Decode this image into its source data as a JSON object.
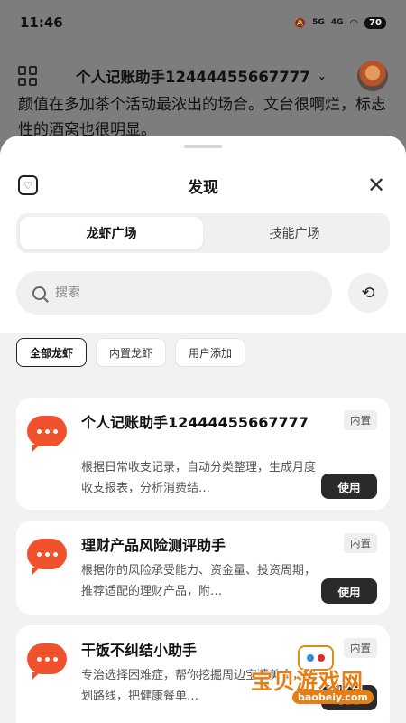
{
  "status": {
    "time": "11:46",
    "signal_a": "5G",
    "signal_b": "4G",
    "battery": "70"
  },
  "background": {
    "title": "个人记账助手12444455667777",
    "text": "颜值在多加茶个活动最浓出的场合。文台很啊烂，标志性的酒窝也很明显。"
  },
  "sheet": {
    "title": "发现",
    "tabs": [
      {
        "label": "龙虾广场",
        "active": true
      },
      {
        "label": "技能广场",
        "active": false
      }
    ],
    "search_placeholder": "搜索",
    "filters": [
      {
        "label": "全部龙虾",
        "active": true
      },
      {
        "label": "内置龙虾",
        "active": false
      },
      {
        "label": "用户添加",
        "active": false
      }
    ],
    "cards": [
      {
        "title": "个人记账助手12444455667777",
        "desc": "根据日常收支记录，自动分类整理，生成月度收支报表，分析消费结…",
        "tag": "内置",
        "button": "使用"
      },
      {
        "title": "理财产品风险测评助手",
        "desc": "根据你的风险承受能力、资金量、投资周期，推荐适配的理财产品，附…",
        "tag": "内置",
        "button": "使用"
      },
      {
        "title": "干饭不纠结小助手",
        "desc": "专治选择困难症，帮你挖掘周边宝藏美食，规划路线，把健康餐单…",
        "tag": "内置",
        "button": "使用"
      }
    ]
  },
  "watermark": {
    "text": "宝贝游戏网",
    "url": "baobeiy.com"
  },
  "colors": {
    "accent": "#f0522e",
    "button_dark": "#2a2a2a",
    "watermark_orange": "#e87e12"
  }
}
